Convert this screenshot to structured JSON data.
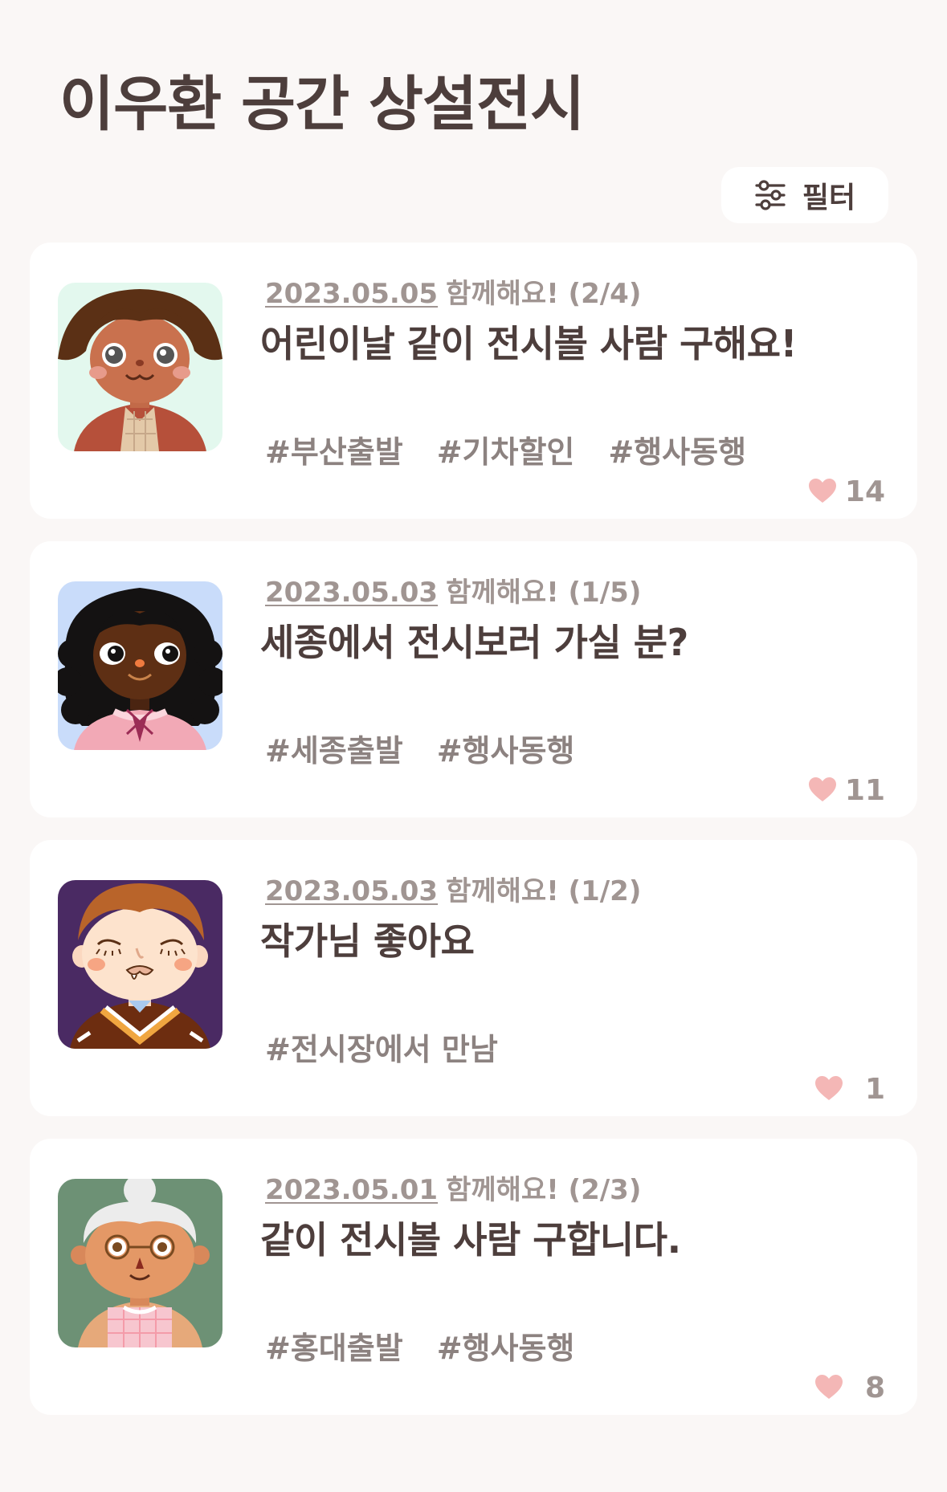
{
  "header": {
    "title": "이우환 공간 상설전시"
  },
  "filter": {
    "label": "필터",
    "icon": "sliders-icon"
  },
  "colors": {
    "background": "#faf7f6",
    "card": "#ffffff",
    "text_dark": "#4d3e3c",
    "text_muted": "#a09592",
    "tag": "#8c8280",
    "heart": "#f4b7b6"
  },
  "posts": [
    {
      "date": "2023.05.05",
      "status": "함께해요! (2/4)",
      "title": "어린이날 같이 전시볼 사람 구해요!",
      "tags": [
        "#부산출발",
        "#기차할인",
        "#행사동행"
      ],
      "likes": "14",
      "avatar": "avatar-girl-brown-hair"
    },
    {
      "date": "2023.05.03",
      "status": "함께해요! (1/5)",
      "title": "세종에서 전시보러 가실 분?",
      "tags": [
        "#세종출발",
        "#행사동행"
      ],
      "likes": "11",
      "avatar": "avatar-girl-curly-black-hair"
    },
    {
      "date": "2023.05.03",
      "status": "함께해요! (1/2)",
      "title": "작가님 좋아요",
      "tags": [
        "#전시장에서 만남"
      ],
      "likes": "1",
      "avatar": "avatar-boy-orange-hair"
    },
    {
      "date": "2023.05.01",
      "status": "함께해요! (2/3)",
      "title": "같이 전시볼 사람 구합니다.",
      "tags": [
        "#홍대출발",
        "#행사동행"
      ],
      "likes": "8",
      "avatar": "avatar-grandma-white-hair"
    }
  ]
}
